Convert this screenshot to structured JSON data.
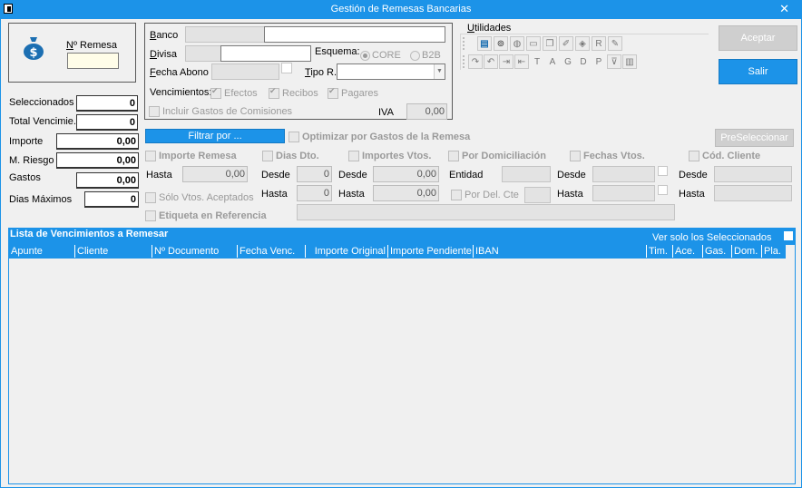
{
  "window": {
    "title": "Gestión de Remesas Bancarias",
    "close_glyph": "✕",
    "app_icon": "window-app-icon",
    "colors": {
      "accent": "#1c93e8",
      "window_bg": "#f0f0f0",
      "disabled_button": "#cfcfcf"
    }
  },
  "remesa": {
    "icon": "money-bag-icon",
    "label": "Nº Remesa",
    "value": ""
  },
  "summary": {
    "seleccionados": {
      "label": "Seleccionados",
      "value": "0"
    },
    "total_vencimie": {
      "label": "Total Vencimie.",
      "value": "0"
    },
    "importe": {
      "label": "Importe",
      "value": "0,00"
    },
    "m_riesgo": {
      "label": "M. Riesgo",
      "value": "0,00"
    },
    "gastos": {
      "label": "Gastos",
      "value": "0,00"
    },
    "dias_maximos": {
      "label": "Dias Máximos",
      "value": "0"
    }
  },
  "bank": {
    "banco_label": "Banco",
    "divisa_label": "Divisa",
    "esquema_label": "Esquema:",
    "esquema_options": [
      "CORE",
      "B2B"
    ],
    "fecha_abono_label": "Fecha Abono",
    "tipo_r_label": "Tipo R.",
    "vencimientos_label": "Vencimientos:",
    "vencimientos_options": [
      "Efectos",
      "Recibos",
      "Pagares"
    ],
    "incluir_label": "Incluir Gastos de Comisiones",
    "iva_label": "IVA",
    "iva_value": "0,00"
  },
  "utilidades": {
    "label": "Utilidades",
    "row1_icons": [
      "report-icon",
      "binoculars-icon",
      "globe-icon",
      "document-icon",
      "copy-icon",
      "eraser-icon",
      "stamp-icon",
      "r-letter-icon",
      "edit-icon"
    ],
    "row2_icons": [
      "redo-icon",
      "undo-icon",
      "forward-icon",
      "back-icon"
    ],
    "row2_letters": [
      "T",
      "A",
      "G",
      "D",
      "P"
    ],
    "row2_extra": [
      "filter-icon",
      "chart-icon"
    ]
  },
  "buttons": {
    "aceptar": "Aceptar",
    "salir": "Salir",
    "filtrar": "Filtrar por ...",
    "preseleccionar": "PreSeleccionar"
  },
  "filters": {
    "optimizar": "Optimizar por Gastos de la Remesa",
    "importe_remesa": "Importe Remesa",
    "hasta_label": "Hasta",
    "importe_remesa_value": "0,00",
    "dias_dto": "Dias Dto.",
    "desde_label": "Desde",
    "dias_desde_value": "0",
    "dias_hasta_value": "0",
    "importes_vtos": "Importes Vtos.",
    "importes_desde_value": "0,00",
    "importes_hasta_value": "0,00",
    "por_domiciliacion": "Por Domiciliación",
    "entidad_label": "Entidad",
    "por_del_cte": "Por Del. Cte",
    "fechas_vtos": "Fechas Vtos.",
    "cod_cliente": "Cód. Cliente",
    "solo_vtos_aceptados": "Sólo Vtos. Aceptados",
    "etiqueta_referencia": "Etiqueta en Referencia"
  },
  "list": {
    "title": "Lista de Vencimientos a Remesar",
    "ver_solo": "Ver solo los Seleccionados",
    "columns": [
      "Apunte",
      "Cliente",
      "Nº Documento",
      "Fecha Venc.",
      "Importe Original",
      "Importe Pendiente",
      "IBAN",
      "Tim.",
      "Ace.",
      "Gas.",
      "Dom.",
      "Pla."
    ]
  }
}
